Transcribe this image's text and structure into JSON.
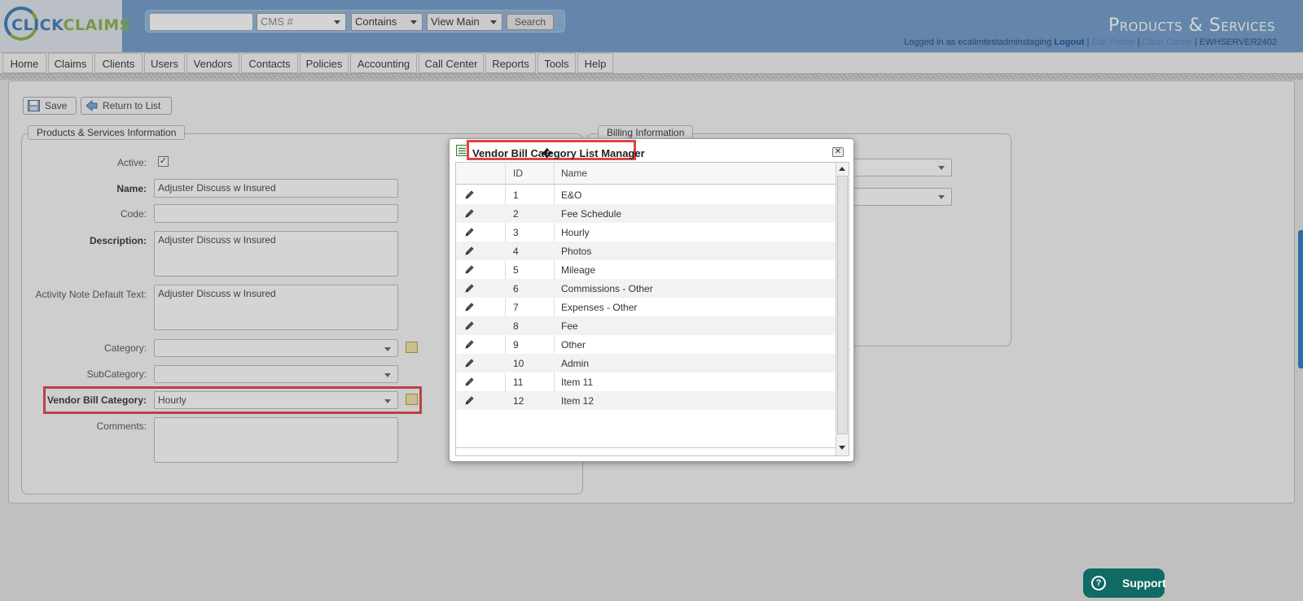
{
  "app": {
    "logo_part1": "CLICK",
    "logo_part2": "CLAIMS",
    "page_title": "Products & Services"
  },
  "search": {
    "input_value": "",
    "type_select": "CMS #",
    "match_select": "Contains",
    "view_select": "View Main",
    "button": "Search"
  },
  "account": {
    "logged_in_text": "Logged in as ecalimtestadminstaging",
    "logout": "Logout",
    "sep1": "|",
    "edit_profile": "Edit Profile",
    "sep2": "|",
    "clear_cache": "Clear Cache",
    "sep3": "|",
    "server": "EWHSERVER2402"
  },
  "nav": {
    "items": [
      {
        "label": "Home"
      },
      {
        "label": "Claims"
      },
      {
        "label": "Clients"
      },
      {
        "label": "Users"
      },
      {
        "label": "Vendors"
      },
      {
        "label": "Contacts"
      },
      {
        "label": "Policies"
      },
      {
        "label": "Accounting"
      },
      {
        "label": "Call Center"
      },
      {
        "label": "Reports"
      },
      {
        "label": "Tools"
      },
      {
        "label": "Help"
      }
    ]
  },
  "toolbar": {
    "save": "Save",
    "return": "Return to List"
  },
  "form": {
    "section_title": "Products & Services Information",
    "active_label": "Active:",
    "active_checked": "✓",
    "name_label": "Name:",
    "name_value": "Adjuster Discuss w Insured",
    "code_label": "Code:",
    "code_value": "",
    "description_label": "Description:",
    "description_value": "Adjuster Discuss w Insured",
    "activity_label": "Activity Note Default Text:",
    "activity_value": "Adjuster Discuss w Insured",
    "category_label": "Category:",
    "category_value": "",
    "subcategory_label": "SubCategory:",
    "subcategory_value": "",
    "vendor_bill_label": "Vendor Bill Category:",
    "vendor_bill_value": "Hourly",
    "comments_label": "Comments:",
    "comments_value": ""
  },
  "billing": {
    "section_title": "Billing Information"
  },
  "dialog": {
    "title": "Vendor Bill Category List Manager",
    "close": "✕",
    "columns": {
      "id": "ID",
      "name": "Name"
    },
    "rows": [
      {
        "id": "1",
        "name": "E&O"
      },
      {
        "id": "2",
        "name": "Fee Schedule"
      },
      {
        "id": "3",
        "name": "Hourly"
      },
      {
        "id": "4",
        "name": "Photos"
      },
      {
        "id": "5",
        "name": "Mileage"
      },
      {
        "id": "6",
        "name": "Commissions - Other"
      },
      {
        "id": "7",
        "name": "Expenses - Other"
      },
      {
        "id": "8",
        "name": "Fee"
      },
      {
        "id": "9",
        "name": "Other"
      },
      {
        "id": "10",
        "name": "Admin"
      },
      {
        "id": "11",
        "name": "Item 11"
      },
      {
        "id": "12",
        "name": "Item 12"
      }
    ]
  },
  "support": {
    "label": "Support",
    "icon": "?"
  },
  "colors": {
    "header": "#6f9bc9",
    "highlight": "#e04343",
    "support": "#0f6b63"
  }
}
